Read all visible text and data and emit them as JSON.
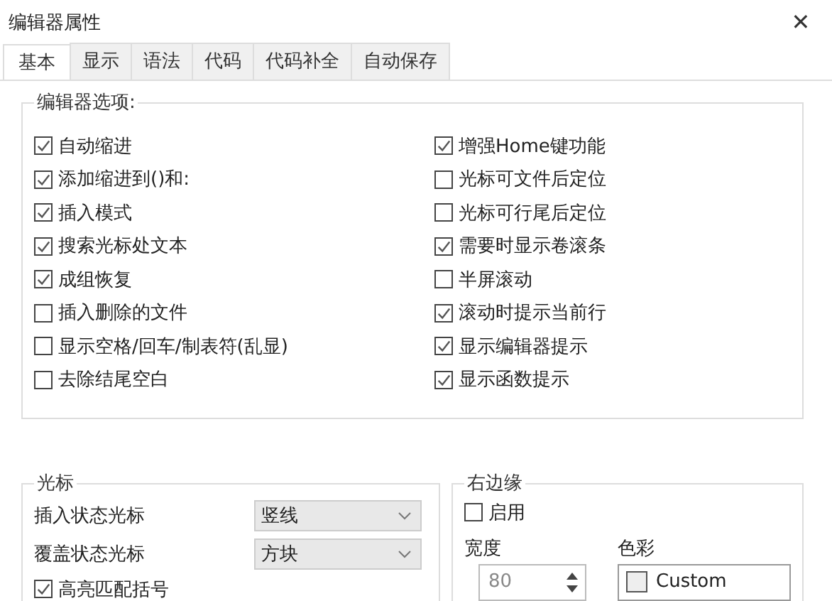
{
  "window": {
    "title": "编辑器属性",
    "close": "✕"
  },
  "tabs": [
    {
      "label": "基本",
      "selected": true
    },
    {
      "label": "显示",
      "selected": false
    },
    {
      "label": "语法",
      "selected": false
    },
    {
      "label": "代码",
      "selected": false
    },
    {
      "label": "代码补全",
      "selected": false
    },
    {
      "label": "自动保存",
      "selected": false
    }
  ],
  "editor_options": {
    "title": "编辑器选项:",
    "left": [
      {
        "label": "自动缩进",
        "checked": true
      },
      {
        "label": "添加缩进到()和:",
        "checked": true
      },
      {
        "label": "插入模式",
        "checked": true
      },
      {
        "label": "搜索光标处文本",
        "checked": true
      },
      {
        "label": "成组恢复",
        "checked": true
      },
      {
        "label": "插入删除的文件",
        "checked": false
      },
      {
        "label": "显示空格/回车/制表符(乱显)",
        "checked": false
      },
      {
        "label": "去除结尾空白",
        "checked": false
      }
    ],
    "right": [
      {
        "label": "增强Home键功能",
        "checked": true
      },
      {
        "label": "光标可文件后定位",
        "checked": false
      },
      {
        "label": "光标可行尾后定位",
        "checked": false
      },
      {
        "label": "需要时显示卷滚条",
        "checked": true
      },
      {
        "label": "半屏滚动",
        "checked": false
      },
      {
        "label": "滚动时提示当前行",
        "checked": true
      },
      {
        "label": "显示编辑器提示",
        "checked": true
      },
      {
        "label": "显示函数提示",
        "checked": true
      }
    ]
  },
  "cursor": {
    "title": "光标",
    "fields": [
      {
        "label": "插入状态光标",
        "value": "竖线"
      },
      {
        "label": "覆盖状态光标",
        "value": "方块"
      }
    ],
    "highlight": {
      "label": "高亮匹配括号",
      "checked": true
    }
  },
  "right_margin": {
    "title": "右边缘",
    "enable": {
      "label": "启用",
      "checked": false
    },
    "width_label": "宽度",
    "width_value": "80",
    "color_label": "色彩",
    "color_value": "Custom"
  }
}
